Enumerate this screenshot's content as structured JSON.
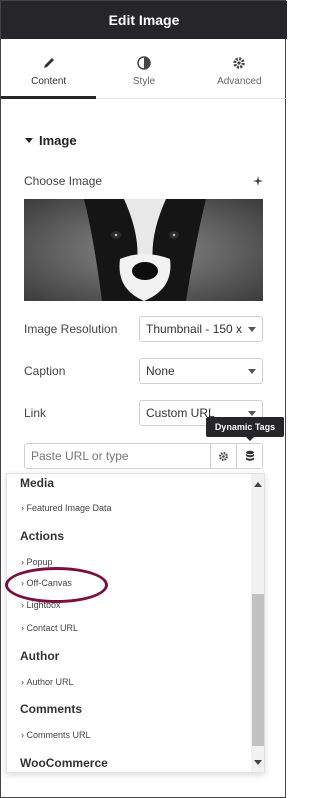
{
  "header": {
    "title": "Edit Image"
  },
  "tabs": [
    {
      "label": "Content",
      "icon": "pencil-icon"
    },
    {
      "label": "Style",
      "icon": "contrast-icon"
    },
    {
      "label": "Advanced",
      "icon": "gear-icon"
    }
  ],
  "section": {
    "title": "Image"
  },
  "fields": {
    "choose_image_label": "Choose Image",
    "resolution_label": "Image Resolution",
    "resolution_value": "Thumbnail - 150 x",
    "caption_label": "Caption",
    "caption_value": "None",
    "link_label": "Link",
    "link_value": "Custom URL",
    "url_placeholder": "Paste URL or type"
  },
  "tooltip": {
    "text": "Dynamic Tags"
  },
  "dropdown": {
    "groups": [
      {
        "title": "Media",
        "items": [
          "Featured Image Data"
        ]
      },
      {
        "title": "Actions",
        "items": [
          "Popup",
          "Off-Canvas",
          "Lightbox",
          "Contact URL"
        ]
      },
      {
        "title": "Author",
        "items": [
          "Author URL"
        ]
      },
      {
        "title": "Comments",
        "items": [
          "Comments URL"
        ]
      },
      {
        "title": "WooCommerce",
        "items": []
      }
    ]
  },
  "colors": {
    "header_bg": "#26262a",
    "highlight": "#7a0e3c"
  }
}
